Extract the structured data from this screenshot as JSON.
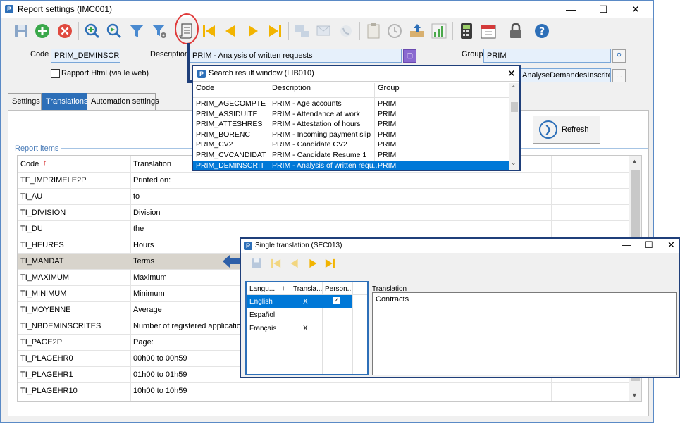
{
  "window": {
    "title": "Report settings (IMC001)",
    "app_icon": "P"
  },
  "form": {
    "code_label": "Code",
    "code_value": "PRIM_DEMINSCRIT",
    "description_label": "Description",
    "description_value": "PRIM - Analysis of written requests",
    "group_label": "Group",
    "group_value": "PRIM",
    "file_value": "AnalyseDemandesInscrites.r",
    "rapport_html_label": "Rapport Html (via le web)",
    "browse_button": "..."
  },
  "tabs": [
    "Settings",
    "Translations",
    "Automation settings"
  ],
  "refresh_label": "Refresh",
  "report_items": {
    "group_label": "Report items",
    "columns": [
      "Code",
      "Translation"
    ],
    "rows": [
      {
        "code": "TF_IMPRIMELE2P",
        "translation": "Printed on:"
      },
      {
        "code": "TI_AU",
        "translation": "to"
      },
      {
        "code": "TI_DIVISION",
        "translation": "Division"
      },
      {
        "code": "TI_DU",
        "translation": "the"
      },
      {
        "code": "TI_HEURES",
        "translation": "Hours"
      },
      {
        "code": "TI_MANDAT",
        "translation": "Terms"
      },
      {
        "code": "TI_MAXIMUM",
        "translation": "Maximum"
      },
      {
        "code": "TI_MINIMUM",
        "translation": "Minimum"
      },
      {
        "code": "TI_MOYENNE",
        "translation": "Average"
      },
      {
        "code": "TI_NBDEMINSCRITES",
        "translation": "Number of registered applications"
      },
      {
        "code": "TI_PAGE2P",
        "translation": "Page:"
      },
      {
        "code": "TI_PLAGEHR0",
        "translation": "00h00 to 00h59"
      },
      {
        "code": "TI_PLAGEHR1",
        "translation": "01h00 to 01h59"
      },
      {
        "code": "TI_PLAGEHR10",
        "translation": "10h00 to 10h59"
      }
    ]
  },
  "search_window": {
    "title": "Search result window (LIB010)",
    "columns": [
      "Code",
      "Description",
      "Group"
    ],
    "rows": [
      {
        "code": "PRIM_AGECOMPTE",
        "description": "PRIM - Age accounts",
        "group": "PRIM"
      },
      {
        "code": "PRIM_ASSIDUITE",
        "description": "PRIM - Attendance at work",
        "group": "PRIM"
      },
      {
        "code": "PRIM_ATTESHRES",
        "description": "PRIM - Attestation of hours",
        "group": "PRIM"
      },
      {
        "code": "PRIM_BORENC",
        "description": "PRIM - Incoming payment slip",
        "group": "PRIM"
      },
      {
        "code": "PRIM_CV2",
        "description": "PRIM - Candidate CV2",
        "group": "PRIM"
      },
      {
        "code": "PRIM_CVCANDIDAT",
        "description": "PRIM - Candidate Resume 1",
        "group": "PRIM"
      },
      {
        "code": "PRIM_DEMINSCRIT",
        "description": "PRIM - Analysis of written requ...",
        "group": "PRIM"
      }
    ]
  },
  "translation_window": {
    "title": "Single translation (SEC013)",
    "columns": [
      "Langu...",
      "Transla...",
      "Person..."
    ],
    "rows": [
      {
        "language": "English",
        "translated": "X",
        "personalized": "✓"
      },
      {
        "language": "Español",
        "translated": "",
        "personalized": ""
      },
      {
        "language": "Français",
        "translated": "X",
        "personalized": ""
      }
    ],
    "translation_label": "Translation",
    "translation_value": "Contracts"
  }
}
